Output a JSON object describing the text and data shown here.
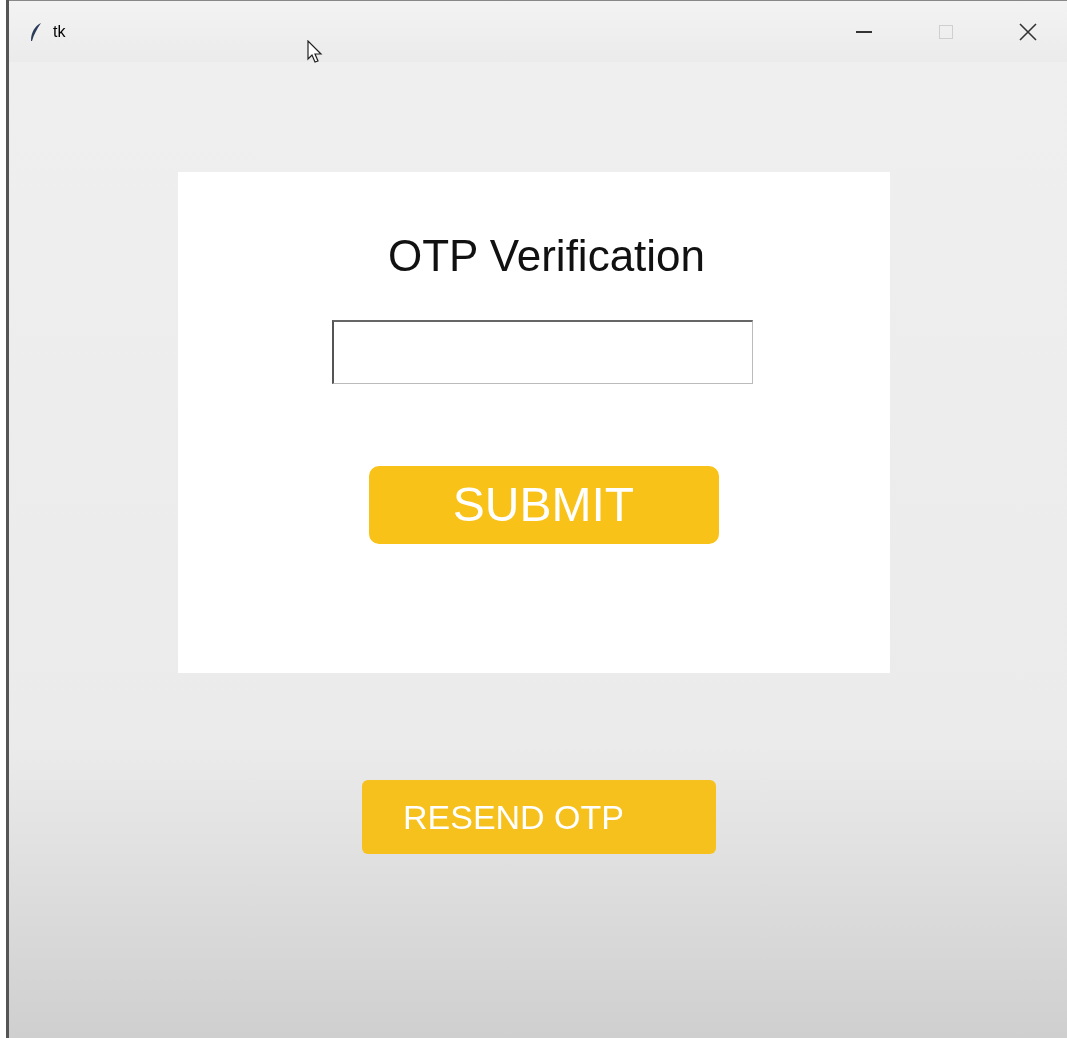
{
  "window": {
    "title": "tk",
    "maximize_disabled": true
  },
  "card": {
    "heading": "OTP Verification",
    "submit_button": "SUBMIT"
  },
  "resend_button": "RESEND OTP"
}
